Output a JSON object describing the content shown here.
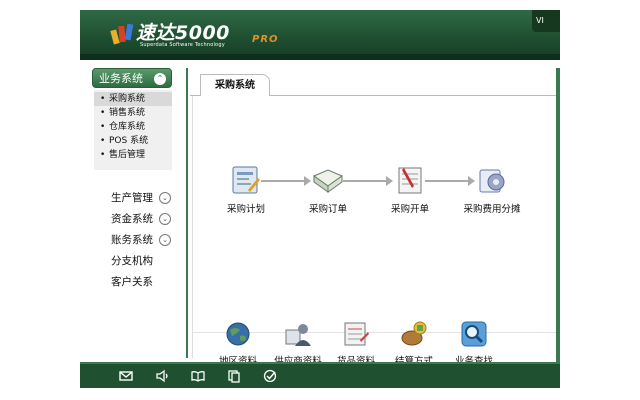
{
  "header": {
    "brand_title": "速达5000",
    "brand_pro": "PRO",
    "brand_subtitle": "Superdata Software Technology",
    "right_badge": "VI"
  },
  "sidebar": {
    "group_label": "业务系统",
    "sub_items": [
      {
        "label": "采购系统",
        "selected": true
      },
      {
        "label": "销售系统",
        "selected": false
      },
      {
        "label": "仓库系统",
        "selected": false
      },
      {
        "label": "POS 系统",
        "selected": false
      },
      {
        "label": "售后管理",
        "selected": false
      }
    ],
    "items": [
      {
        "label": "生产管理",
        "has_chevron": true
      },
      {
        "label": "资金系统",
        "has_chevron": true
      },
      {
        "label": "账务系统",
        "has_chevron": true
      },
      {
        "label": "分支机构",
        "has_chevron": false
      },
      {
        "label": "客户关系",
        "has_chevron": false
      }
    ]
  },
  "main": {
    "tab_label": "采购系统",
    "flow": [
      {
        "label": "采购计划",
        "icon": "purchase-plan-icon"
      },
      {
        "label": "采购订单",
        "icon": "purchase-order-icon"
      },
      {
        "label": "采购开单",
        "icon": "purchase-invoice-icon"
      },
      {
        "label": "采购费用分摊",
        "icon": "expense-allocation-icon"
      }
    ],
    "quick_links": [
      {
        "label": "地区资料",
        "icon": "globe-icon"
      },
      {
        "label": "供应商资料",
        "icon": "supplier-icon"
      },
      {
        "label": "货品资料",
        "icon": "goods-icon"
      },
      {
        "label": "结算方式",
        "icon": "settlement-icon"
      },
      {
        "label": "业务查找",
        "icon": "search-icon"
      }
    ]
  },
  "footer": {
    "icons": [
      "mail-icon",
      "speaker-icon",
      "book-icon",
      "copy-icon",
      "check-icon"
    ]
  },
  "colors": {
    "brand_green": "#1f4f31",
    "accent_orange": "#e0902a"
  }
}
